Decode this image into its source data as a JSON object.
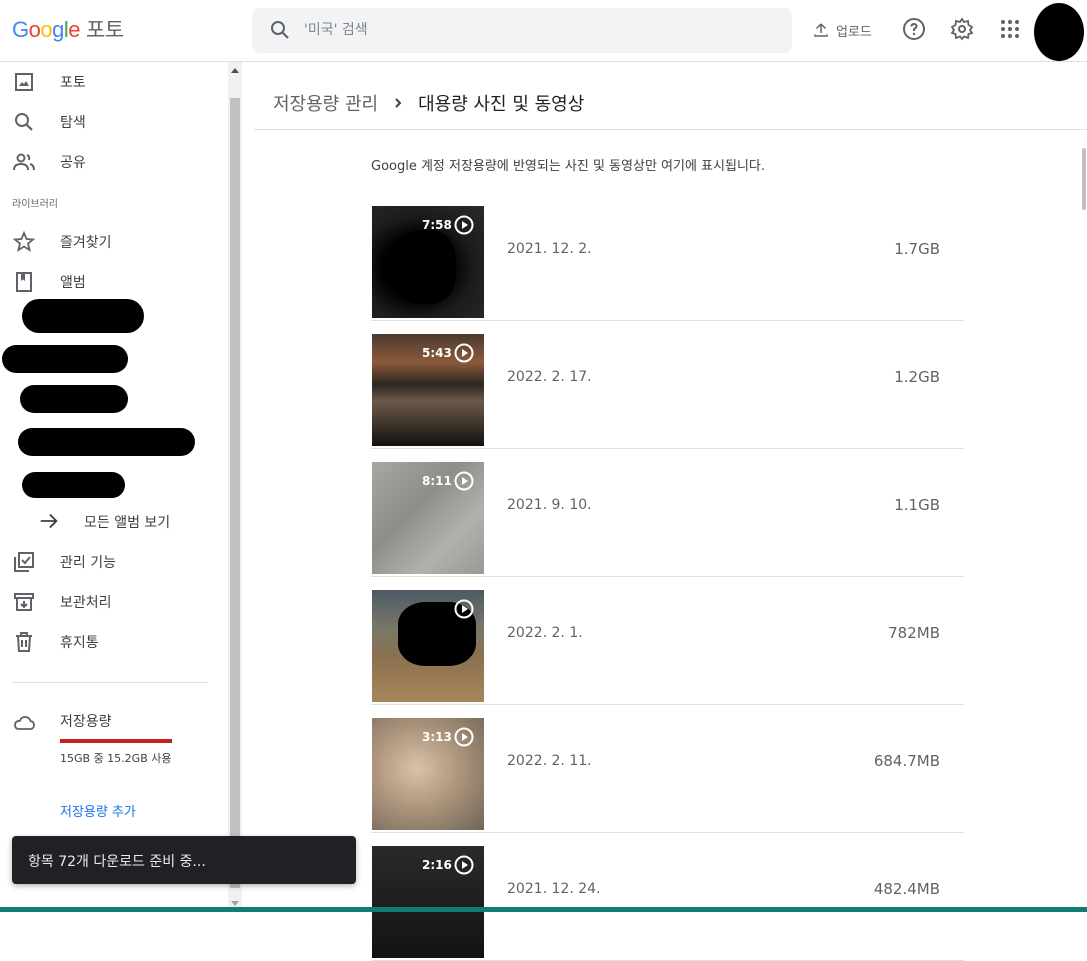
{
  "header": {
    "logo": {
      "g1": "G",
      "o1": "o",
      "o2": "o",
      "g2": "g",
      "l": "l",
      "e": "e",
      "product": "포토"
    },
    "search_placeholder": "'미국' 검색",
    "upload_label": "업로드",
    "icons": [
      "search-icon",
      "upload-icon",
      "help-icon",
      "settings-icon",
      "apps-icon"
    ]
  },
  "sidebar": {
    "items": [
      {
        "label": "포토",
        "icon": "photo-icon"
      },
      {
        "label": "탐색",
        "icon": "search-icon"
      },
      {
        "label": "공유",
        "icon": "people-icon"
      }
    ],
    "library_label": "라이브러리",
    "library_items": [
      {
        "label": "즐겨찾기",
        "icon": "star-icon"
      },
      {
        "label": "앨범",
        "icon": "album-icon"
      }
    ],
    "see_all_albums": "모든 앨범 보기",
    "tools": [
      {
        "label": "관리 기능",
        "icon": "checklist-icon"
      },
      {
        "label": "보관처리",
        "icon": "archive-icon"
      },
      {
        "label": "휴지통",
        "icon": "trash-icon"
      }
    ],
    "storage": {
      "title": "저장용량",
      "usage_text": "15GB 중 15.2GB 사용",
      "used_fraction": 1.0,
      "add_link": "저장용량 추가",
      "bar_color": "#c5221f"
    }
  },
  "main": {
    "breadcrumb": {
      "parent": "저장용량 관리",
      "current": "대용량 사진 및 동영상"
    },
    "info": "Google 계정 저장용량에 반영되는 사진 및 동영상만 여기에 표시됩니다.",
    "rows": [
      {
        "duration": "7:58",
        "date": "2021. 12. 2.",
        "size": "1.7GB"
      },
      {
        "duration": "5:43",
        "date": "2022. 2. 17.",
        "size": "1.2GB"
      },
      {
        "duration": "8:11",
        "date": "2021. 9. 10.",
        "size": "1.1GB"
      },
      {
        "duration": "",
        "date": "2022. 2. 1.",
        "size": "782MB"
      },
      {
        "duration": "3:13",
        "date": "2022. 2. 11.",
        "size": "684.7MB"
      },
      {
        "duration": "2:16",
        "date": "2021. 12. 24.",
        "size": "482.4MB"
      }
    ]
  },
  "toast": {
    "text": "항목 72개 다운로드 준비 중..."
  },
  "colors": {
    "accent_blue": "#1a73e8",
    "storage_red": "#c5221f",
    "toast_bg": "#202124"
  }
}
